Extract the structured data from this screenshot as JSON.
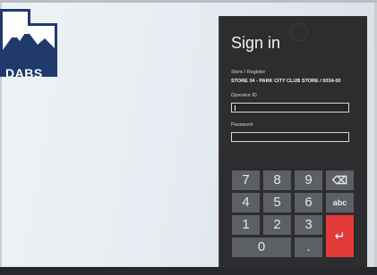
{
  "brand": {
    "logo_text": "DABS"
  },
  "signin": {
    "title": "Sign in",
    "store_label": "Store / Register",
    "store_value": "STORE 34 - PARK CITY CLUB STORE / 0034-00",
    "operator_label": "Operator ID",
    "operator_value": "",
    "password_label": "Password",
    "password_value": ""
  },
  "keypad": {
    "k7": "7",
    "k8": "8",
    "k9": "9",
    "backspace": "⌫",
    "k4": "4",
    "k5": "5",
    "k6": "6",
    "abc": "abc",
    "k1": "1",
    "k2": "2",
    "k3": "3",
    "enter": "↵",
    "k0": "0",
    "dot": "."
  },
  "colors": {
    "panel": "#2d2d30",
    "key": "#5c5f63",
    "enter": "#e53a3a",
    "logo": "#1f3a6b"
  }
}
